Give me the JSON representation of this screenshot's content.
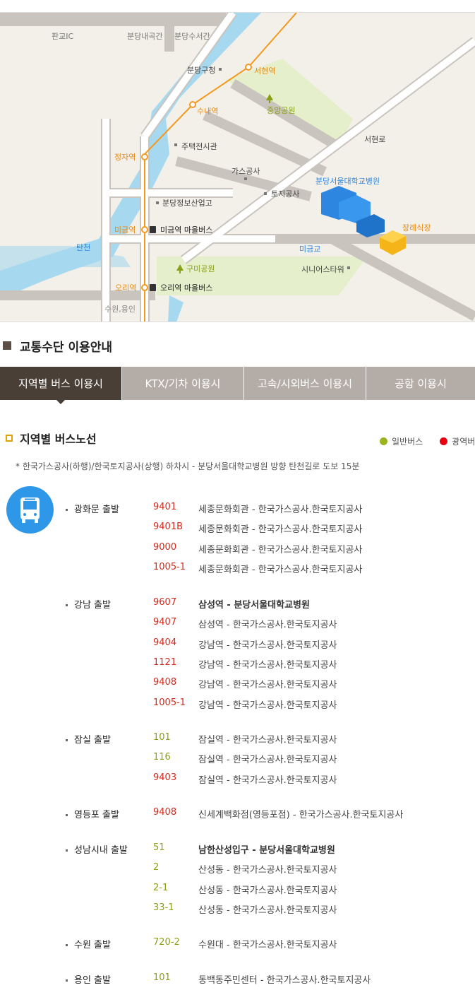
{
  "map": {
    "labels": {
      "pangyo_ic": "판교IC",
      "bundang_naegokgan": "분당내곡간",
      "bundang_suseogan": "분당수서간",
      "bundang_gucheong": "분당구청",
      "seohyeon_station": "서현역",
      "sunae_station": "수내역",
      "jungang_park": "중앙공원",
      "seohyeon_ro": "서현로",
      "housing_center": "주택전시관",
      "jeongja_station": "정자역",
      "gas_corp": "가스공사",
      "land_corp": "토지공사",
      "hospital": "분당서울대학교병원",
      "bundang_info_school": "분당정보산업고",
      "funeral_hall": "장례식장",
      "migeum_station": "미금역",
      "migeum_bus": "미금역 마을버스",
      "tancheon": "탄천",
      "migeum_bridge": "미금교",
      "gumi_park": "구미공원",
      "senior_tower": "시니어스타워",
      "ori_station": "오리역",
      "ori_bus": "오리역 마을버스",
      "suwon_yongin": "수원,용인"
    }
  },
  "section_title": "교통수단 이용안내",
  "tabs": [
    {
      "label": "지역별 버스 이용시"
    },
    {
      "label": "KTX/기차 이용시"
    },
    {
      "label": "고속/시외버스 이용시"
    },
    {
      "label": "공항 이용시"
    }
  ],
  "subsection_title": "지역별 버스노선",
  "legend": {
    "regular": {
      "label": "일반버스",
      "color": "#9db21e"
    },
    "express": {
      "label": "광역버",
      "color": "#e60012"
    }
  },
  "note": "* 한국가스공사(하행)/한국토지공사(상행) 하차시 - 분당서울대학교병원 방향 탄천길로 도보 15분",
  "routes": [
    {
      "origin": "광화문 출발",
      "buses": [
        {
          "num": "9401",
          "type": "red",
          "dest": "세종문화회관 - 한국가스공사.한국토지공사",
          "bold": false
        },
        {
          "num": "9401B",
          "type": "red",
          "dest": "세종문화회관 - 한국가스공사.한국토지공사",
          "bold": false
        },
        {
          "num": "9000",
          "type": "red",
          "dest": "세종문화회관 - 한국가스공사.한국토지공사",
          "bold": false
        },
        {
          "num": "1005-1",
          "type": "red",
          "dest": "세종문화회관 - 한국가스공사.한국토지공사",
          "bold": false
        }
      ]
    },
    {
      "origin": "강남 출발",
      "buses": [
        {
          "num": "9607",
          "type": "red",
          "dest": "삼성역 - 분당서울대학교병원",
          "bold": true
        },
        {
          "num": "9407",
          "type": "red",
          "dest": "삼성역 - 한국가스공사.한국토지공사",
          "bold": false
        },
        {
          "num": "9404",
          "type": "red",
          "dest": "강남역 - 한국가스공사.한국토지공사",
          "bold": false
        },
        {
          "num": "1121",
          "type": "red",
          "dest": "강남역 - 한국가스공사.한국토지공사",
          "bold": false
        },
        {
          "num": "9408",
          "type": "red",
          "dest": "강남역 - 한국가스공사.한국토지공사",
          "bold": false
        },
        {
          "num": "1005-1",
          "type": "red",
          "dest": "강남역 - 한국가스공사.한국토지공사",
          "bold": false
        }
      ]
    },
    {
      "origin": "잠실 출발",
      "buses": [
        {
          "num": "101",
          "type": "green",
          "dest": "잠실역 - 한국가스공사.한국토지공사",
          "bold": false
        },
        {
          "num": "116",
          "type": "green",
          "dest": "잠실역 - 한국가스공사.한국토지공사",
          "bold": false
        },
        {
          "num": "9403",
          "type": "red",
          "dest": "잠실역 - 한국가스공사.한국토지공사",
          "bold": false
        }
      ]
    },
    {
      "origin": "영등포 출발",
      "buses": [
        {
          "num": "9408",
          "type": "red",
          "dest": "신세계백화점(영등포점) - 한국가스공사.한국토지공사",
          "bold": false
        }
      ]
    },
    {
      "origin": "성남시내 출발",
      "buses": [
        {
          "num": "51",
          "type": "green",
          "dest": "남한산성입구 - 분당서울대학교병원",
          "bold": true
        },
        {
          "num": "2",
          "type": "green",
          "dest": "산성동 - 한국가스공사.한국토지공사",
          "bold": false
        },
        {
          "num": "2-1",
          "type": "green",
          "dest": "산성동 - 한국가스공사.한국토지공사",
          "bold": false
        },
        {
          "num": "33-1",
          "type": "green",
          "dest": "산성동 - 한국가스공사.한국토지공사",
          "bold": false
        }
      ]
    },
    {
      "origin": "수원 출발",
      "buses": [
        {
          "num": "720-2",
          "type": "green",
          "dest": "수원대 - 한국가스공사.한국토지공사",
          "bold": false
        }
      ]
    },
    {
      "origin": "용인 출발",
      "buses": [
        {
          "num": "101",
          "type": "green",
          "dest": "동백동주민센터 - 한국가스공사.한국토지공사",
          "bold": false
        }
      ]
    }
  ]
}
